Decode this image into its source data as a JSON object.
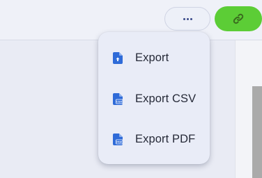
{
  "toolbar": {
    "more_icon": "more-horizontal-icon",
    "link_icon": "link-icon",
    "link_button_color": "#5ccd36"
  },
  "menu": {
    "items": [
      {
        "label": "Export",
        "icon": "file-upload-icon"
      },
      {
        "label": "Export CSV",
        "icon": "file-csv-icon"
      },
      {
        "label": "Export PDF",
        "icon": "file-pdf-icon"
      }
    ],
    "icon_color": "#2f6bd8"
  }
}
